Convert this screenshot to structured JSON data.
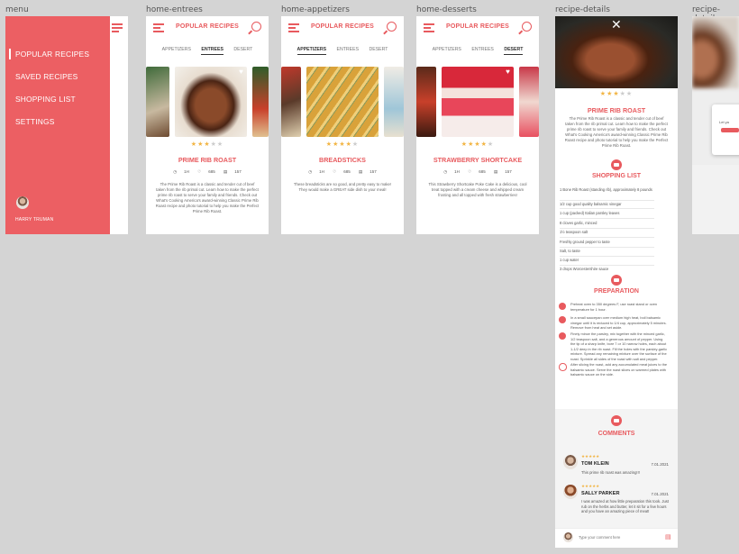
{
  "artboards": {
    "menu": "menu",
    "home_entrees": "home-entrees",
    "home_appetizers": "home-appetizers",
    "home_desserts": "home-desserts",
    "recipe_details": "recipe-details",
    "recipe_details_2": "recipe-details"
  },
  "menu": {
    "items": [
      "POPULAR RECIPES",
      "SAVED RECIPES",
      "SHOPPING LIST",
      "SETTINGS"
    ],
    "user_name": "HARRY TRUMAN"
  },
  "app": {
    "title": "POPULAR RECIPES",
    "tabs": [
      "APPETIZERS",
      "ENTREES",
      "DESERT"
    ],
    "icons": {
      "menu": "hamburger-icon",
      "search": "search-icon",
      "favorite": "heart-icon",
      "time": "clock-icon",
      "likes": "heart-outline-icon",
      "comments": "comment-icon"
    },
    "accent": "#e85a5e"
  },
  "entrees": {
    "active_tab": "ENTREES",
    "recipe": "PRIME RIB ROAST",
    "rating": 3,
    "time": "1H",
    "likes": "685",
    "comments": "157",
    "description": "The Prime Rib Roast is a classic and tender cut of beef taken from the rib primal cut. Learn how to make the perfect prime rib roast to serve your family and friends. Check out What's Cooking America's award-winning Classic Prime Rib Roast recipe and photo tutorial to help you make the Perfect Prime Rib Roast."
  },
  "appetizers": {
    "active_tab": "APPETIZERS",
    "recipe": "BREADSTICKS",
    "rating": 4,
    "time": "1H",
    "likes": "685",
    "comments": "157",
    "description": "These breadsticks are so good, and pretty easy to make! They would make a GREAT side dish to your meal!"
  },
  "desserts": {
    "active_tab": "DESERT",
    "recipe": "STRAWBERRY SHORTCAKE",
    "rating": 4,
    "time": "1H",
    "likes": "685",
    "comments": "157",
    "description": "This Strawberry Shortcake Poke Cake is a delicious, cool treat topped with a cream cheese and whipped cream frosting and all topped with fresh strawberries!"
  },
  "details": {
    "recipe": "PRIME RIB ROAST",
    "rating": 3,
    "description": "The Prime Rib Roast is a classic and tender cut of beef taken from the rib primal cut. Learn how to make the perfect prime rib roast to serve your family and friends. Check out What's Cooking America's award-winning Classic Prime Rib Roast recipe and photo tutorial to help you make the Perfect Prime Rib Roast.",
    "shopping_title": "SHOPPING LIST",
    "ingredients": [
      "1 Bone Rib Roast (standing rib), approximately 8 pounds",
      "1/2 cup good quality balsamic vinegar",
      "1 cup (packed) Italian parsley leaves",
      "8 cloves garlic, minced",
      "1½ teaspoon salt",
      "Freshly ground pepper to taste",
      "Salt, to taste",
      "1 cup water",
      "3 drops Worcestershire sauce"
    ],
    "prep_title": "PREPARATION",
    "steps": [
      "Preheat oven to 350 degrees F, use roast stand or oven temperature for 1 hour.",
      "In a small saucepan over medium high heat, boil balsamic vinegar until it is reduced to 1/4 cup, approximately 5 minutes. Remove from heat and set aside.",
      "Finely mince the parsley, mix together with the minced garlic, 1/2 teaspoon salt, and a generous amount of pepper. Using the tip of a sharp knife, bore 7 or 10 narrow holes, each about 1-1/2 deep in the rib roast. Fill the holes with the parsley-garlic mixture. Spread any remaining mixture over the surface of the roast. Sprinkle all sides of the roast with salt and pepper.",
      "After slicing the roast, add any accumulated meat juices to the balsamic sauce. Serve the roast slices on warmed plates with balsamic sauce on the side."
    ],
    "comments_title": "COMMENTS",
    "comments": [
      {
        "name": "TOM KLEIN",
        "date": "7.01.2021",
        "text": "This prime rib roast was amazing!!!",
        "rating": 5
      },
      {
        "name": "SALLY PARKER",
        "date": "7.01.2021",
        "text": "I was amazed at how little preparation this took. Just rub on the herbs and butter, let it sit for a few hours and you have an amazing piece of meat!",
        "rating": 5
      }
    ],
    "comment_placeholder": "Type your comment here"
  },
  "partial": {
    "text": "Let ya"
  }
}
